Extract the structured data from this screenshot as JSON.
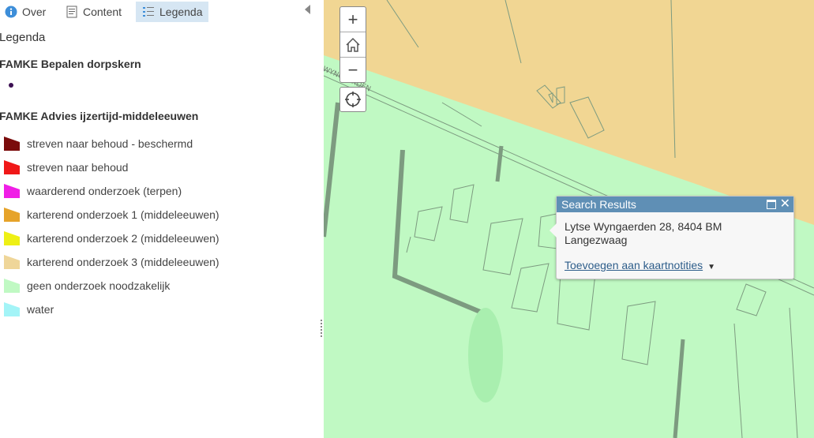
{
  "tabs": [
    {
      "label": "Over",
      "icon": "info-icon"
    },
    {
      "label": "Content",
      "icon": "content-icon"
    },
    {
      "label": "Legenda",
      "icon": "legend-list-icon",
      "active": true
    }
  ],
  "legend": {
    "title": "Legenda",
    "layers": [
      {
        "title": "FAMKE Bepalen dorpskern"
      },
      {
        "title": "FAMKE Advies ijzertijd-middeleeuwen"
      }
    ],
    "dot_color": "#3c1053",
    "items": [
      {
        "label": "streven naar behoud - beschermd",
        "color": "#7a0b0b"
      },
      {
        "label": "streven naar behoud",
        "color": "#f01818"
      },
      {
        "label": "waarderend onderzoek (terpen)",
        "color": "#f01ee6"
      },
      {
        "label": "karterend onderzoek 1 (middeleeuwen)",
        "color": "#e6a32a"
      },
      {
        "label": "karterend onderzoek 2 (middeleeuwen)",
        "color": "#eef015"
      },
      {
        "label": "karterend onderzoek 3 (middeleeuwen)",
        "color": "#efd699"
      },
      {
        "label": "geen onderzoek noodzakelijk",
        "color": "#c0f9c3"
      },
      {
        "label": "water",
        "color": "#a3f4f7"
      }
    ]
  },
  "map": {
    "colors": {
      "green": "#c0f9c3",
      "orange": "#f1d693",
      "line": "#7d9b80",
      "street_line": "#6f7f6f"
    },
    "street_label": "WYNGAERDEN",
    "controls": {
      "zoom_in": "+",
      "zoom_out": "−"
    }
  },
  "popup": {
    "title": "Search Results",
    "address": "Lytse Wyngaerden 28, 8404 BM Langezwaag",
    "link": "Toevoegen aan kaartnotities",
    "caret": "▼",
    "close": "✕"
  }
}
